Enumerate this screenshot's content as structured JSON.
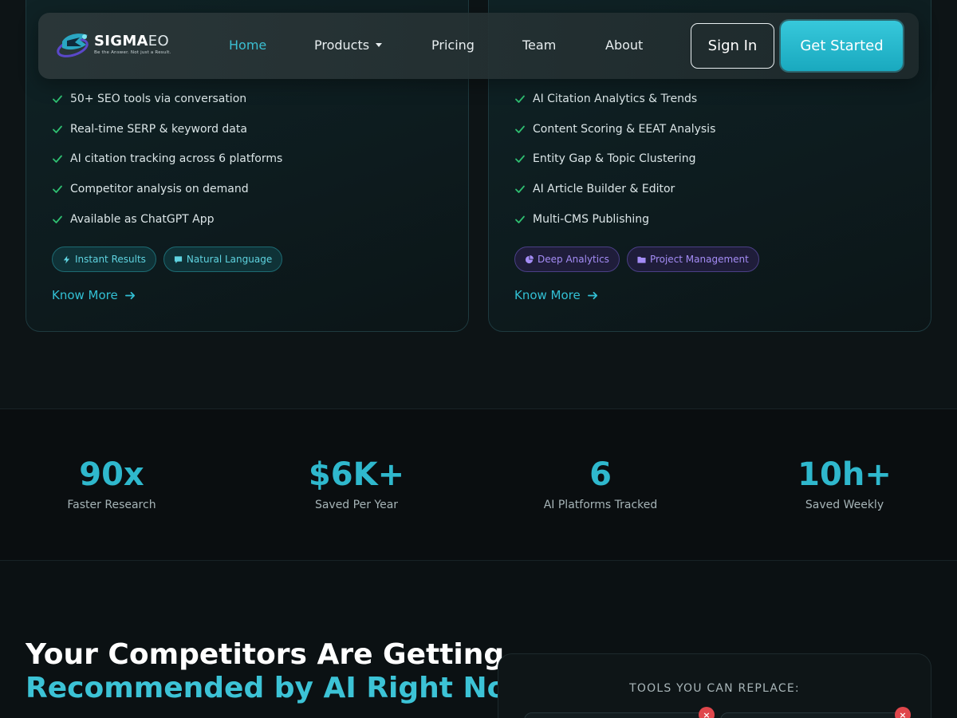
{
  "colors": {
    "accent": "#32c0d4",
    "check": "#2fbf71",
    "purple": "#a48cf5",
    "background": "#0b1113"
  },
  "navbar": {
    "logo": {
      "name_bold": "SIGMA",
      "name_light": "EO",
      "tagline": "Be the Answer. Not just a Result.",
      "icon": "sigmaeo-logo-icon"
    },
    "links": [
      {
        "label": "Home",
        "active": true
      },
      {
        "label": "Products",
        "dropdown": true
      },
      {
        "label": "Pricing"
      },
      {
        "label": "Team"
      },
      {
        "label": "About"
      }
    ],
    "sign_in": "Sign In",
    "get_started": "Get Started"
  },
  "cards": [
    {
      "features": [
        "50+ SEO tools via conversation",
        "Real-time SERP & keyword data",
        "AI citation tracking across 6 platforms",
        "Competitor analysis on demand",
        "Available as ChatGPT App"
      ],
      "tags": [
        {
          "label": "Instant Results",
          "icon": "bolt-icon"
        },
        {
          "label": "Natural Language",
          "icon": "chat-icon"
        }
      ],
      "know_more": "Know More"
    },
    {
      "features": [
        "AI Citation Analytics & Trends",
        "Content Scoring & EEAT Analysis",
        "Entity Gap & Topic Clustering",
        "AI Article Builder & Editor",
        "Multi-CMS Publishing"
      ],
      "tags": [
        {
          "label": "Deep Analytics",
          "icon": "pie-chart-icon"
        },
        {
          "label": "Project Management",
          "icon": "folder-icon"
        }
      ],
      "know_more": "Know More"
    }
  ],
  "stats": [
    {
      "value": "90x",
      "label": "Faster Research"
    },
    {
      "value": "$6K+",
      "label": "Saved Per Year"
    },
    {
      "value": "6",
      "label": "AI Platforms Tracked"
    },
    {
      "value": "10h+",
      "label": "Saved Weekly"
    }
  ],
  "competitors": {
    "headline_line1": "Your Competitors Are Getting",
    "headline_line2": "Recommended by AI Right Now",
    "tools_title": "TOOLS YOU CAN REPLACE:"
  }
}
